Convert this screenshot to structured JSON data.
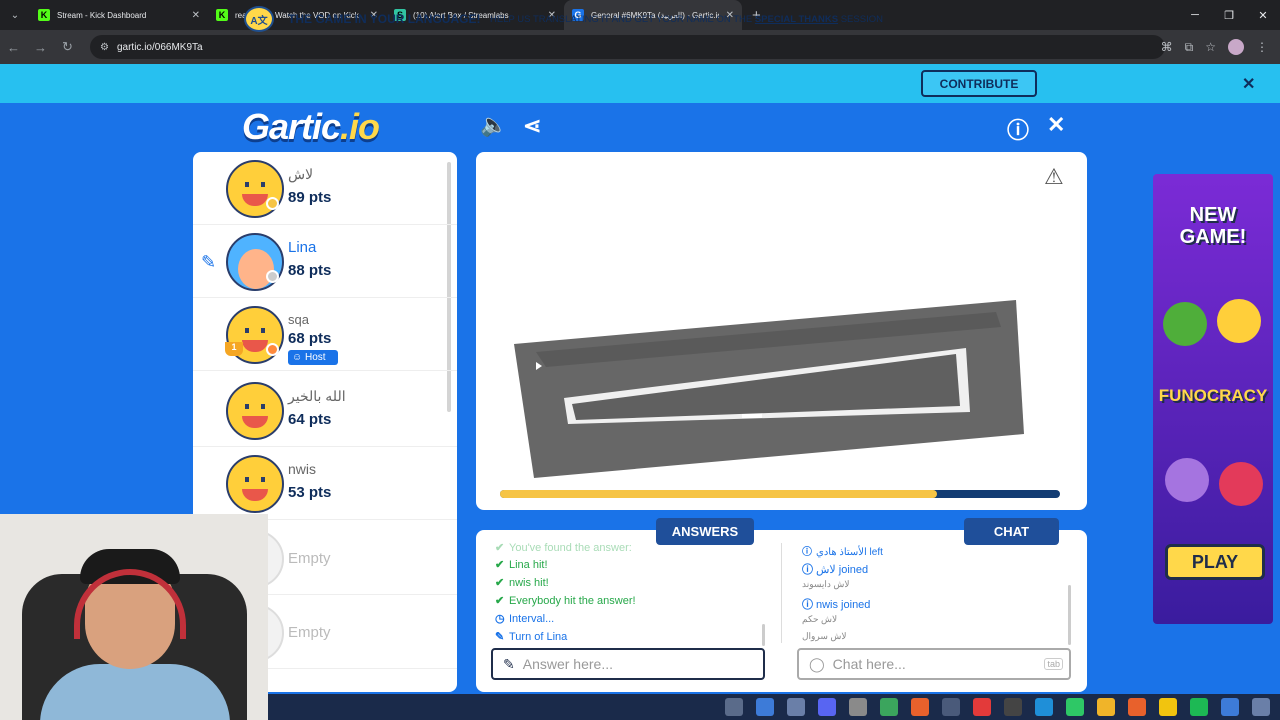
{
  "browser": {
    "tabs": [
      {
        "title": "Stream - Kick Dashboard",
        "fav": "K",
        "color": "#53fc18"
      },
      {
        "title": "realdhmy - Watch the VOD on Kick",
        "fav": "K",
        "color": "#53fc18"
      },
      {
        "title": "(10) Alert Box / Streamlabs",
        "fav": "S",
        "color": "#31c3a2"
      },
      {
        "title": "General #6MK9Ta (العربية) - Gartic.io",
        "fav": "G",
        "color": "#1a73e8"
      }
    ],
    "url": "gartic.io/066MK9Ta"
  },
  "banner": {
    "title": "THE GAME IN YOUR LANGUAGE!",
    "text_before": "HELP US TRANSLATING IT AND GET YOUR NAME ON THE ",
    "text_link": "SPECIAL THANKS",
    "text_after": " SESSION",
    "button": "CONTRIBUTE"
  },
  "logo": {
    "main": "Gartic",
    "suffix": ".io"
  },
  "players": [
    {
      "name": "لاش",
      "points": "89 pts",
      "status_color": "#f6c445"
    },
    {
      "name": "Lina",
      "points": "88 pts",
      "status_color": "#cccccc"
    },
    {
      "name": "sqa",
      "points": "68 pts",
      "status_color": "#ff8a3d",
      "badge": "Host"
    },
    {
      "name": "الله بالخير",
      "points": "64 pts"
    },
    {
      "name": "nwis",
      "points": "53 pts"
    },
    {
      "name": "Empty"
    },
    {
      "name": "Empty"
    }
  ],
  "timer": {
    "progress": 0.78
  },
  "answers": {
    "tab_label": "ANSWERS",
    "messages": [
      {
        "icon": "✔",
        "text": "You've found the answer:"
      },
      {
        "icon": "✔",
        "text": "Lina hit!"
      },
      {
        "icon": "✔",
        "text": "nwis hit!"
      },
      {
        "icon": "✔",
        "text": "Everybody hit the answer!"
      },
      {
        "icon": "◷",
        "text": "Interval..."
      },
      {
        "icon": "✎",
        "text": "Turn of Lina"
      }
    ],
    "placeholder": "Answer here..."
  },
  "chat": {
    "tab_label": "CHAT",
    "messages": [
      {
        "text": "الأستاذ هادي left",
        "kind": "system"
      },
      {
        "text": "لاش joined",
        "kind": "system"
      },
      {
        "text": "لاش دايسوند",
        "kind": "user"
      },
      {
        "text": "nwis joined",
        "kind": "system"
      },
      {
        "text": "لاش حكم",
        "kind": "user"
      },
      {
        "text": "لاش سروال",
        "kind": "user"
      }
    ],
    "placeholder": "Chat here...",
    "tab_hint": "tab"
  },
  "ad": {
    "title_line1": "NEW",
    "title_line2": "GAME!",
    "game": "FUNOCRACY",
    "button": "PLAY"
  }
}
